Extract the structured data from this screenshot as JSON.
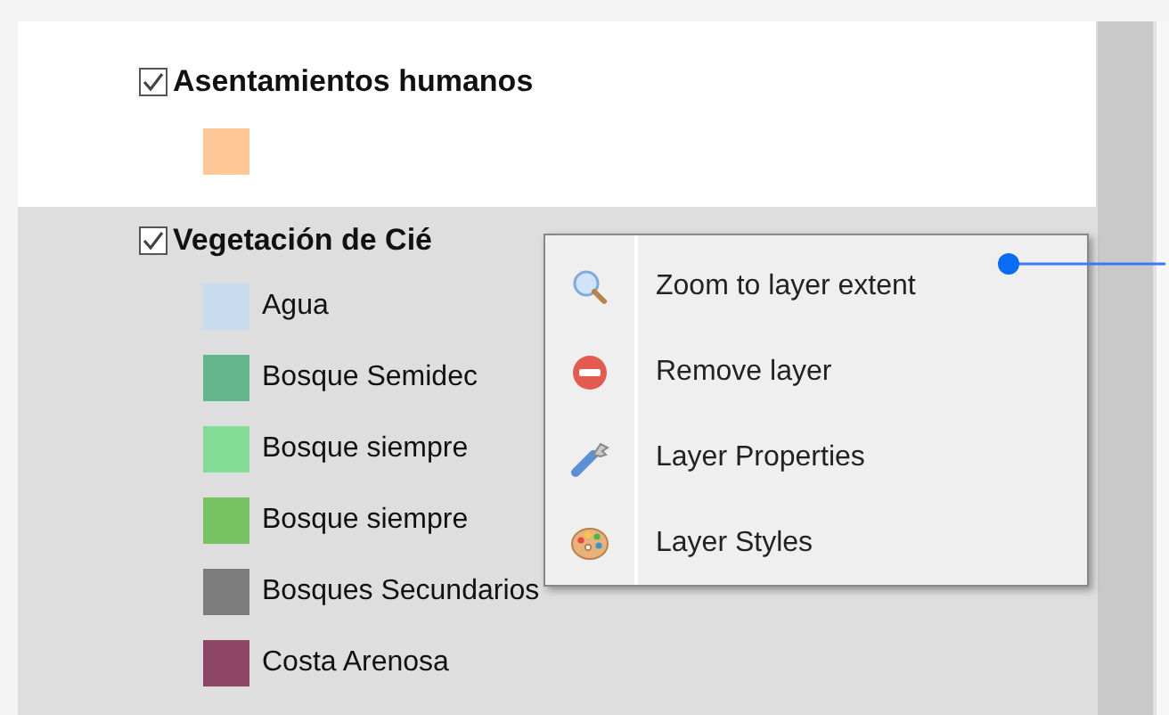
{
  "layers": [
    {
      "name": "Asentamientos humanos",
      "checked": true,
      "selected": false,
      "legend": [
        {
          "color": "#ffc896"
        }
      ]
    },
    {
      "name": "Vegetación de Cié",
      "checked": true,
      "selected": true,
      "legend": [
        {
          "label": "Agua",
          "color": "#c8dcf0"
        },
        {
          "label": "Bosque Semidec",
          "color": "#64b48c"
        },
        {
          "label": "Bosque siempre",
          "color": "#82dc96"
        },
        {
          "label": "Bosque siempre",
          "color": "#78c364"
        },
        {
          "label": "Bosques Secundarios",
          "color": "#7d7d7d"
        },
        {
          "label": "Costa Arenosa",
          "color": "#8c4664"
        }
      ]
    }
  ],
  "context_menu": {
    "items": [
      {
        "label": "Zoom to layer extent"
      },
      {
        "label": "Remove layer"
      },
      {
        "label": "Layer Properties"
      },
      {
        "label": "Layer Styles"
      }
    ]
  }
}
